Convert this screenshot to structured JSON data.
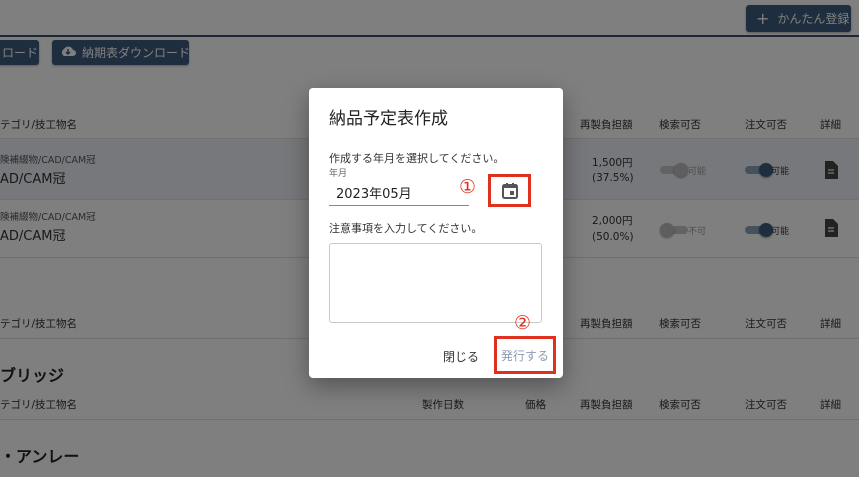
{
  "header": {
    "register_button": "かんたん登録",
    "download_partial": "ロード",
    "delivery_download": "納期表ダウンロード"
  },
  "table": {
    "col_category": "テゴリ/技工物名",
    "col_days": "製作日数",
    "col_price": "価格",
    "col_remake": "再製負担額",
    "col_search": "検索可否",
    "col_order": "注文可否",
    "col_detail": "詳細"
  },
  "rows": [
    {
      "category": "険補綴物/CAD/CAM冠",
      "name": "AD/CAM冠",
      "remake": "1,500円",
      "remake_pct": "(37.5%)",
      "search": "可能",
      "order": "可能"
    },
    {
      "category": "険補綴物/CAD/CAM冠",
      "name": "AD/CAM冠",
      "remake": "2,000円",
      "remake_pct": "(50.0%)",
      "search": "不可",
      "order": "可能"
    }
  ],
  "sections": {
    "bridge": "ブリッジ",
    "inlay": "・アンレー"
  },
  "dialog": {
    "title": "納品予定表作成",
    "prompt_month": "作成する年月を選択してください。",
    "field_label": "年月",
    "month_value": "2023年05月",
    "prompt_notes": "注意事項を入力してください。",
    "close": "閉じる",
    "issue": "発行する"
  },
  "markers": {
    "one": "①",
    "two": "②"
  },
  "colors": {
    "accent": "#3f5d7d",
    "highlight": "#e0301e"
  }
}
